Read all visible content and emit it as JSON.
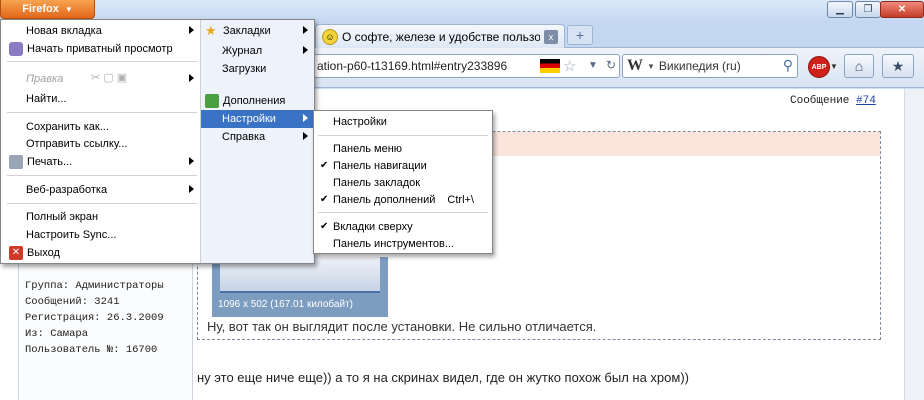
{
  "window": {
    "menu_button": "Firefox",
    "menu_button_arrow": "▼"
  },
  "tabs": [
    {
      "title": "О софте, железе и удобстве пользова...",
      "close": "x"
    }
  ],
  "navbar": {
    "url": "ation-p60-t13169.html#entry233896",
    "search_engine": "W",
    "search_placeholder": "Википедия (ru)",
    "abp_label": "ABP"
  },
  "firefox_menu": {
    "left": [
      {
        "label": "Новая вкладка",
        "submenu": true
      },
      {
        "label": "Начать приватный просмотр",
        "icon": "mask-icon"
      },
      {
        "label": "Правка",
        "submenu": true,
        "disabled": true
      },
      {
        "label": "Найти..."
      },
      {
        "label": "Сохранить как..."
      },
      {
        "label": "Отправить ссылку..."
      },
      {
        "label": "Печать...",
        "submenu": true,
        "icon": "printer-icon"
      },
      {
        "label": "Веб-разработка",
        "submenu": true
      },
      {
        "label": "Полный экран"
      },
      {
        "label": "Настроить Sync..."
      },
      {
        "label": "Выход",
        "icon": "exit-icon"
      }
    ],
    "right": [
      {
        "label": "Закладки",
        "submenu": true,
        "icon": "star-icon"
      },
      {
        "label": "Журнал",
        "submenu": true
      },
      {
        "label": "Загрузки"
      },
      {
        "label": "Дополнения",
        "icon": "puzzle-icon"
      },
      {
        "label": "Настройки",
        "submenu": true,
        "highlighted": true
      },
      {
        "label": "Справка",
        "submenu": true
      }
    ]
  },
  "settings_submenu": {
    "items": [
      {
        "label": "Настройки",
        "checked": false
      },
      {
        "label": "Панель меню",
        "checked": false
      },
      {
        "label": "Панель навигации",
        "checked": true
      },
      {
        "label": "Панель закладок",
        "checked": false
      },
      {
        "label": "Панель дополнений",
        "shortcut": "Ctrl+\\",
        "checked": true
      },
      {
        "label": "Вкладки сверху",
        "checked": true
      },
      {
        "label": "Панель инструментов...",
        "checked": false
      }
    ]
  },
  "post": {
    "message_label": "Сообщение",
    "message_number": "#74",
    "user_info": [
      "Группа: Администраторы",
      "Сообщений: 3241",
      "Регистрация: 26.3.2009",
      "Из: Самара",
      "Пользователь №: 16700"
    ],
    "thumbnail_caption": "1096 x 502 (167.01 килобайт)",
    "quote_text": "Ну, вот так он выглядит после установки. Не сильно отличается.",
    "body_text": "ну это еще ниче еще)) а то я на скринах видел, где он жутко похож был на хром))"
  },
  "colors": {
    "firefox_orange": "#e2661a",
    "highlight": "#3a72c4",
    "chrome_blue": "#c4d7f0"
  }
}
